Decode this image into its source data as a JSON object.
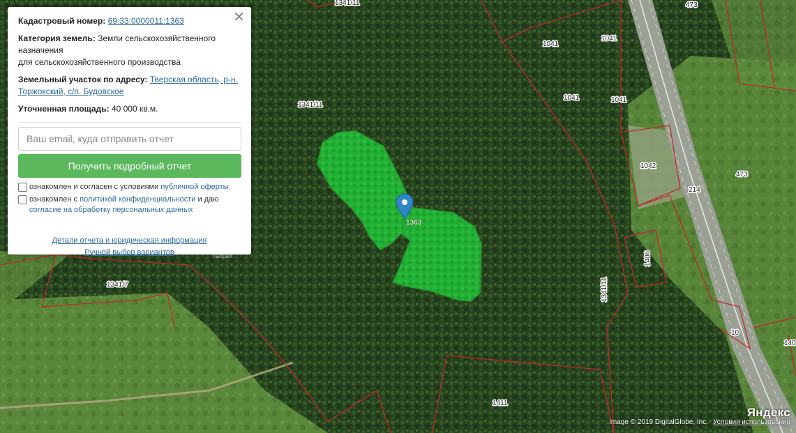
{
  "popup": {
    "close_icon": "close-icon",
    "cadastral_label": "Кадастровый номер:",
    "cadastral_value": "69:33:0000011:1363",
    "category_label": "Категория земель:",
    "category_value_1": "Земли сельскохозяйственного назначения",
    "category_value_2": "для сельскохозяйственного производства",
    "address_label": "Земельный участок по адресу:",
    "address_value": "Тверская область, р-н. Торжокский, с/п. Будовское",
    "area_label": "Уточненная площадь:",
    "area_value": "40 000 кв.м.",
    "email_placeholder": "Ваш email, куда отправить отчет",
    "email_value": "",
    "submit_label": "Получить подробный отчет",
    "consent1_text": "ознакомлен и согласен с условиями",
    "consent1_link": "публичной оферты",
    "consent1_checked": false,
    "consent2_text": "ознакомлен с",
    "consent2_link1": "политикой конфиденциальности",
    "consent2_mid": "и даю",
    "consent2_link2": "согласие на обработку персональных данных",
    "consent2_checked": false,
    "details_link": "Детали отчета и юридическая информация",
    "manual_link": "Ручной выбор вариантов"
  },
  "map": {
    "parcel_labels": {
      "p1341_11_top": "1341/11",
      "p473_top": "473",
      "p1041_a": "1041",
      "p1041_b": "1041",
      "p1041_c": "1041",
      "p1041_d": "1041",
      "p1341_11_mid": "1341/11",
      "p1042": "1042",
      "p473_right": "473",
      "p214": "214",
      "p1363": "1363",
      "p1341_7": "1341/7",
      "p1341_11_vertical": "1341/11",
      "p1406": "1406",
      "p10": "10",
      "p140": "140",
      "p1411": "1411"
    },
    "place_label": "тапрех",
    "selected_parcel_color": "#22c33a",
    "boundary_color": "#c0282d",
    "marker_color": "#2f86c9",
    "marker_icon": "map-pin-icon"
  },
  "attribution": {
    "imagery": "Image © 2019 DigitalGlobe, Inc.",
    "terms_link": "Условия использования",
    "provider_logo": "Яндекс"
  }
}
